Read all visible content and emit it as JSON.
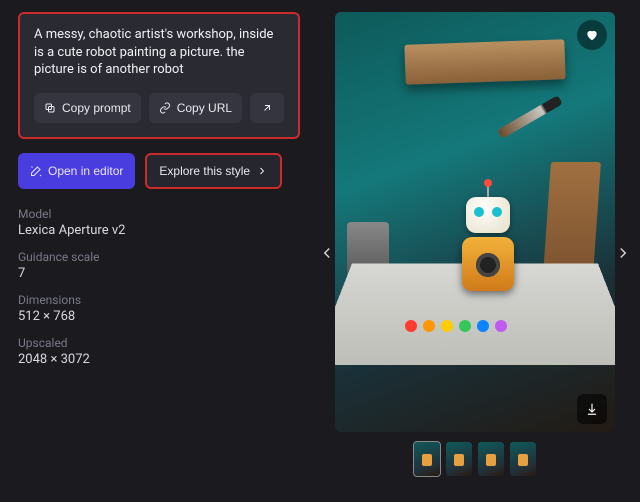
{
  "prompt": {
    "text": "A messy, chaotic artist's workshop, inside is a cute robot painting a picture. the picture is of another robot",
    "copy_prompt_label": "Copy prompt",
    "copy_url_label": "Copy URL"
  },
  "actions": {
    "open_editor_label": "Open in editor",
    "explore_style_label": "Explore this style"
  },
  "meta": {
    "model_label": "Model",
    "model_value": "Lexica Aperture v2",
    "guidance_label": "Guidance scale",
    "guidance_value": "7",
    "dimensions_label": "Dimensions",
    "dimensions_value": "512 × 768",
    "upscaled_label": "Upscaled",
    "upscaled_value": "2048 × 3072"
  },
  "palette": [
    "#ff3b30",
    "#ff9500",
    "#ffcc00",
    "#34c759",
    "#0a84ff",
    "#bf5af2"
  ]
}
